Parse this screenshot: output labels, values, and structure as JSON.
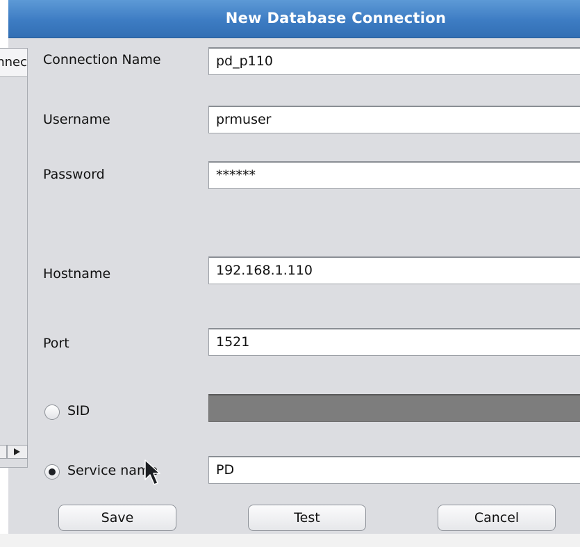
{
  "window": {
    "title": "New Database Connection"
  },
  "left_panel": {
    "header_text": "Connec"
  },
  "form": {
    "connection_name": {
      "label": "Connection Name",
      "value": "pd_p110"
    },
    "username": {
      "label": "Username",
      "value": "prmuser"
    },
    "password": {
      "label": "Password",
      "value": "******"
    },
    "hostname": {
      "label": "Hostname",
      "value": "192.168.1.110"
    },
    "port": {
      "label": "Port",
      "value": "1521"
    },
    "sid": {
      "label": "SID",
      "value": "",
      "selected": false
    },
    "service_name": {
      "label": "Service name",
      "value": "PD",
      "selected": true
    }
  },
  "buttons": {
    "save": "Save",
    "test": "Test",
    "cancel": "Cancel"
  },
  "colors": {
    "title_bar": "#3d7cc3",
    "panel_bg": "#dcdde1",
    "disabled_field": "#7d7d7d"
  }
}
